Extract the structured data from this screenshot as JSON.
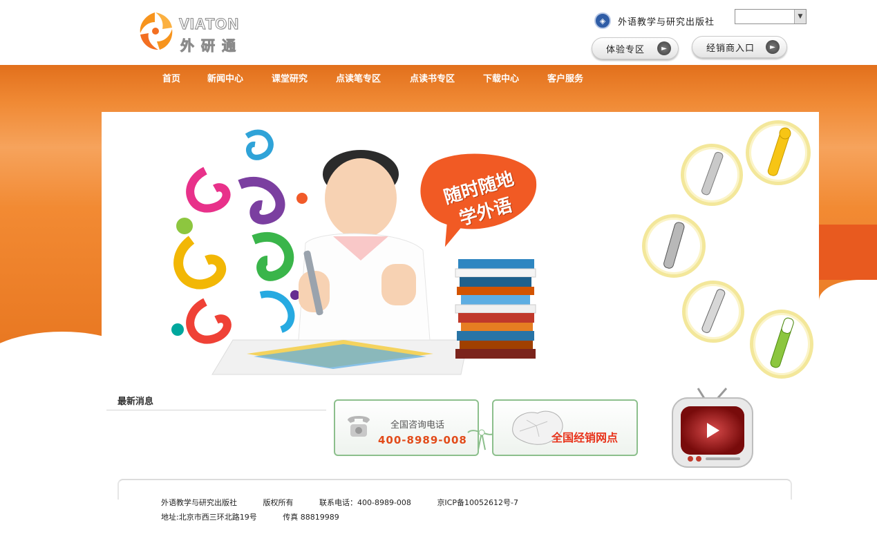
{
  "brand": {
    "logo_en": "VIATON",
    "logo_cn": "外研通"
  },
  "header": {
    "publisher": "外语教学与研究出版社",
    "publisher_icon": "fltrp-emblem-icon",
    "site_select_value": "",
    "buttons": {
      "trial": "体验专区",
      "dealer": "经销商入口"
    }
  },
  "nav": [
    "首页",
    "新闻中心",
    "课堂研究",
    "点读笔专区",
    "点读书专区",
    "下载中心",
    "客户服务"
  ],
  "banner": {
    "slogan_line1": "随时随地",
    "slogan_line2": "学外语"
  },
  "news": {
    "title": "最新消息"
  },
  "contact": {
    "label": "全国咨询电话",
    "phone": "400-8989-008"
  },
  "dealers": {
    "label": "全国经销网点"
  },
  "footer": {
    "publisher": "外语教学与研究出版社",
    "copyright": "版权所有",
    "phone": "联系电话：400-8989-008",
    "icp": "京ICP备10052612号-7",
    "address": "地址:北京市西三环北路19号",
    "fax": "传真 88819989"
  },
  "colors": {
    "orange": "#ef7f2a",
    "accent_red": "#e24b1a",
    "box_green": "#8cbf8c"
  }
}
